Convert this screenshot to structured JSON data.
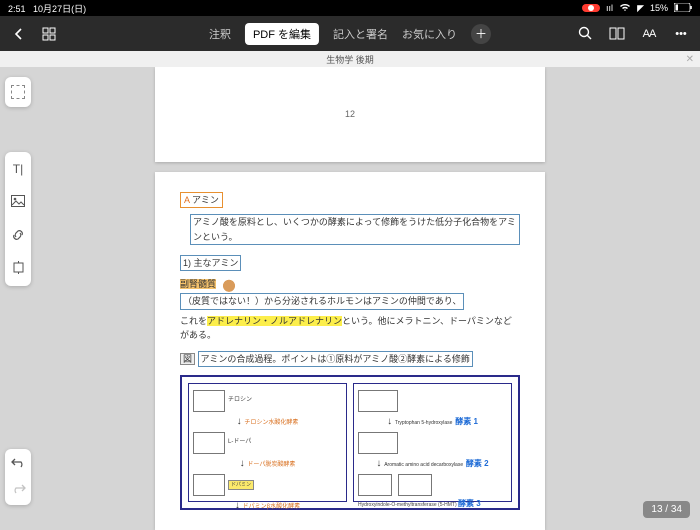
{
  "statusbar": {
    "time": "2:51",
    "date": "10月27日(日)",
    "battery": "15%"
  },
  "toolbar": {
    "tabs": {
      "annotate": "注釈",
      "edit": "PDF を編集",
      "fill_sign": "記入と署名",
      "favorites": "お気に入り"
    }
  },
  "document": {
    "title": "生物学 後期"
  },
  "page_top": {
    "number": "12"
  },
  "content": {
    "section_label_a": "A",
    "section_title": "アミン",
    "def_line": "アミノ酸を原料とし、いくつかの酵素によって修飾をうけた低分子化合物をアミンという。",
    "sub_label": "1) 主なアミン",
    "organ_label": "副腎髄質",
    "organ_note": "（皮質ではない！）",
    "organ_line_rest": "から分泌されるホルモンはアミンの仲間であり、",
    "line2_pre": "これを",
    "hormones": "アドレナリン・ノルアドレナリン",
    "line2_post": "という。他にメラトニン、ドーパミンなどがある。",
    "fig_label": "図",
    "fig_caption": "アミンの合成過程。ポイントは①原料がアミノ酸②酵素による修飾",
    "left_col": {
      "mol1": "チロシン",
      "enz1": "チロシン水酸化酵素",
      "mol2": "L-ドーパ",
      "enz2": "ドーパ脱炭酸酵素",
      "mol3": "ドパミン",
      "enz3": "ドパミンβ水酸化酵素"
    },
    "right_col": {
      "enz_fixed1": "Tryptophan 5-hydroxylase",
      "enz_label1": "酵素 1",
      "enz_fixed2": "Aromatic amino acid decarboxylase",
      "enz_label2": "酵素 2",
      "text3": "Hydroxyindole-O-methyltransferase (5-HMT)",
      "enz_label3": "酵素 3"
    }
  },
  "pagination": {
    "current": 13,
    "total": 34,
    "label": "13 / 34"
  }
}
